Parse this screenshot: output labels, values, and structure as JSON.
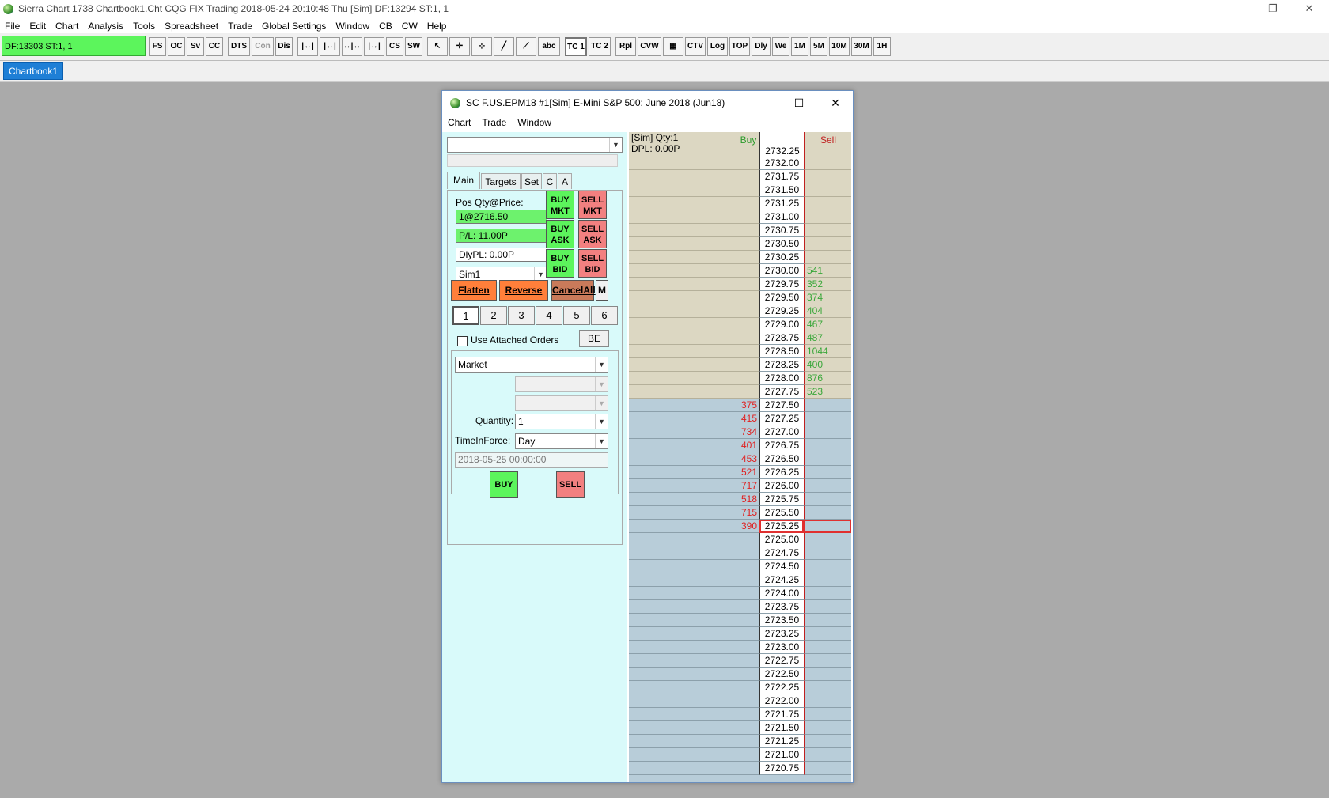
{
  "app": {
    "title": "Sierra Chart 1738 Chartbook1.Cht  CQG FIX Trading 2018-05-24  20:10:48 Thu [Sim]  DF:13294  ST:1, 1",
    "win_minimize": "—",
    "win_restore": "❐",
    "win_close": "✕"
  },
  "menu": [
    "File",
    "Edit",
    "Chart",
    "Analysis",
    "Tools",
    "Spreadsheet",
    "Trade",
    "Global Settings",
    "Window",
    "CB",
    "CW",
    "Help"
  ],
  "toolbar": {
    "status": "DF:13303  ST:1, 1",
    "buttons": [
      "FS",
      "OC",
      "Sv",
      "CC",
      "DTS",
      "Con",
      "Dis",
      "|↔|",
      "|↔|",
      "↔|↔",
      "|↔|",
      "CS",
      "SW",
      "↖",
      "✛",
      "⊹",
      "╱",
      "⟋",
      "abc",
      "TC 1",
      "TC 2",
      "Rpl",
      "CVW",
      "▦",
      "CTV",
      "Log",
      "TOP",
      "Dly",
      "We",
      "1M",
      "5M",
      "10M",
      "30M",
      "1H"
    ],
    "active_index": 19,
    "dim_index": 5
  },
  "chartbook_tab": "Chartbook1",
  "child": {
    "title": "SC F.US.EPM18  #1[Sim]   E-Mini S&P 500: June 2018 (Jun18)",
    "min": "—",
    "max": "☐",
    "close": "✕",
    "menu": [
      "Chart",
      "Trade",
      "Window"
    ]
  },
  "trade": {
    "symbol_dropdown": "",
    "tabs": [
      "Main",
      "Targets",
      "Set",
      "C",
      "A"
    ],
    "pos_label": "Pos Qty@Price:",
    "pos_value": "1@2716.50",
    "pl_value": "P/L: 11.00P",
    "dlypl_value": "DlyPL: 0.00P",
    "account": "Sim1",
    "buy_mkt": "BUY MKT",
    "sell_mkt": "SELL MKT",
    "buy_ask": "BUY ASK",
    "sell_ask": "SELL ASK",
    "buy_bid": "BUY BID",
    "sell_bid": "SELL BID",
    "flatten": "Flatten",
    "reverse": "Reverse",
    "cancel_all": "CancelAll",
    "m": "M",
    "qty_buttons": [
      "1",
      "2",
      "3",
      "4",
      "5",
      "6"
    ],
    "use_attached": "Use Attached Orders",
    "be": "BE",
    "order_type": "Market",
    "quantity_label": "Quantity:",
    "quantity": "1",
    "tif_label": "TimeInForce:",
    "tif": "Day",
    "datetime": "2018-05-25  00:00:00",
    "buy": "BUY",
    "sell": "SELL"
  },
  "ladder": {
    "info_line1": "[Sim]  Qty:1",
    "info_line2": "DPL: 0.00P",
    "buy_header": "Buy",
    "sell_header": "Sell",
    "header_price": "2732.25",
    "rows": [
      {
        "price": "2732.00",
        "buy": "",
        "sell": ""
      },
      {
        "price": "2731.75",
        "buy": "",
        "sell": ""
      },
      {
        "price": "2731.50",
        "buy": "",
        "sell": ""
      },
      {
        "price": "2731.25",
        "buy": "",
        "sell": ""
      },
      {
        "price": "2731.00",
        "buy": "",
        "sell": ""
      },
      {
        "price": "2730.75",
        "buy": "",
        "sell": ""
      },
      {
        "price": "2730.50",
        "buy": "",
        "sell": ""
      },
      {
        "price": "2730.25",
        "buy": "",
        "sell": ""
      },
      {
        "price": "2730.00",
        "buy": "",
        "sell": "541"
      },
      {
        "price": "2729.75",
        "buy": "",
        "sell": "352"
      },
      {
        "price": "2729.50",
        "buy": "",
        "sell": "374"
      },
      {
        "price": "2729.25",
        "buy": "",
        "sell": "404"
      },
      {
        "price": "2729.00",
        "buy": "",
        "sell": "467"
      },
      {
        "price": "2728.75",
        "buy": "",
        "sell": "487"
      },
      {
        "price": "2728.50",
        "buy": "",
        "sell": "1044"
      },
      {
        "price": "2728.25",
        "buy": "",
        "sell": "400"
      },
      {
        "price": "2728.00",
        "buy": "",
        "sell": "876"
      },
      {
        "price": "2727.75",
        "buy": "",
        "sell": "523"
      },
      {
        "price": "2727.50",
        "buy": "375",
        "sell": ""
      },
      {
        "price": "2727.25",
        "buy": "415",
        "sell": ""
      },
      {
        "price": "2727.00",
        "buy": "734",
        "sell": ""
      },
      {
        "price": "2726.75",
        "buy": "401",
        "sell": ""
      },
      {
        "price": "2726.50",
        "buy": "453",
        "sell": ""
      },
      {
        "price": "2726.25",
        "buy": "521",
        "sell": ""
      },
      {
        "price": "2726.00",
        "buy": "717",
        "sell": ""
      },
      {
        "price": "2725.75",
        "buy": "518",
        "sell": ""
      },
      {
        "price": "2725.50",
        "buy": "715",
        "sell": ""
      },
      {
        "price": "2725.25",
        "buy": "390",
        "sell": ""
      },
      {
        "price": "2725.00",
        "buy": "",
        "sell": ""
      },
      {
        "price": "2724.75",
        "buy": "",
        "sell": ""
      },
      {
        "price": "2724.50",
        "buy": "",
        "sell": ""
      },
      {
        "price": "2724.25",
        "buy": "",
        "sell": ""
      },
      {
        "price": "2724.00",
        "buy": "",
        "sell": ""
      },
      {
        "price": "2723.75",
        "buy": "",
        "sell": ""
      },
      {
        "price": "2723.50",
        "buy": "",
        "sell": ""
      },
      {
        "price": "2723.25",
        "buy": "",
        "sell": ""
      },
      {
        "price": "2723.00",
        "buy": "",
        "sell": ""
      },
      {
        "price": "2722.75",
        "buy": "",
        "sell": ""
      },
      {
        "price": "2722.50",
        "buy": "",
        "sell": ""
      },
      {
        "price": "2722.25",
        "buy": "",
        "sell": ""
      },
      {
        "price": "2722.00",
        "buy": "",
        "sell": ""
      },
      {
        "price": "2721.75",
        "buy": "",
        "sell": ""
      },
      {
        "price": "2721.50",
        "buy": "",
        "sell": ""
      },
      {
        "price": "2721.25",
        "buy": "",
        "sell": ""
      },
      {
        "price": "2721.00",
        "buy": "",
        "sell": ""
      },
      {
        "price": "2720.75",
        "buy": "",
        "sell": ""
      }
    ],
    "tan_rows": 18,
    "highlight_index": 27
  }
}
